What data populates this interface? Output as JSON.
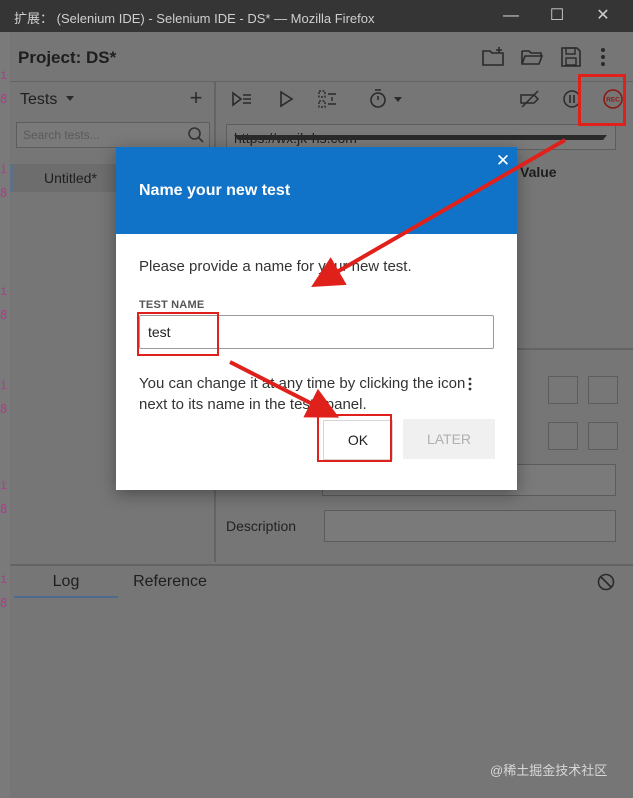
{
  "window": {
    "title": "扩展： (Selenium IDE) - Selenium IDE - DS* — Mozilla Firefox",
    "minimize": "—",
    "maximize": "☐",
    "close": "✕"
  },
  "project": {
    "label": "Project:",
    "name": "DS*"
  },
  "tests_panel": {
    "header": "Tests",
    "add": "+",
    "search_placeholder": "Search tests...",
    "items": [
      "Untitled*"
    ]
  },
  "editor": {
    "base_url": "https://wx.jk-hs.com",
    "value_column": "Value",
    "description_label": "Description"
  },
  "bottom_tabs": {
    "log": "Log",
    "reference": "Reference"
  },
  "dialog": {
    "title": "Name your new test",
    "message": "Please provide a name for your new test.",
    "field_label": "TEST NAME",
    "field_value": "test",
    "hint": "You can change it at any time by clicking the icon next to its name in the tests panel.",
    "ok_label": "OK",
    "later_label": "LATER",
    "close": "✕"
  },
  "annotations": {
    "color": "#e0211b"
  },
  "watermark": "@稀土掘金技术社区",
  "colors": {
    "dialog_header": "#1173c8",
    "overlay": "#6b6b6b"
  }
}
